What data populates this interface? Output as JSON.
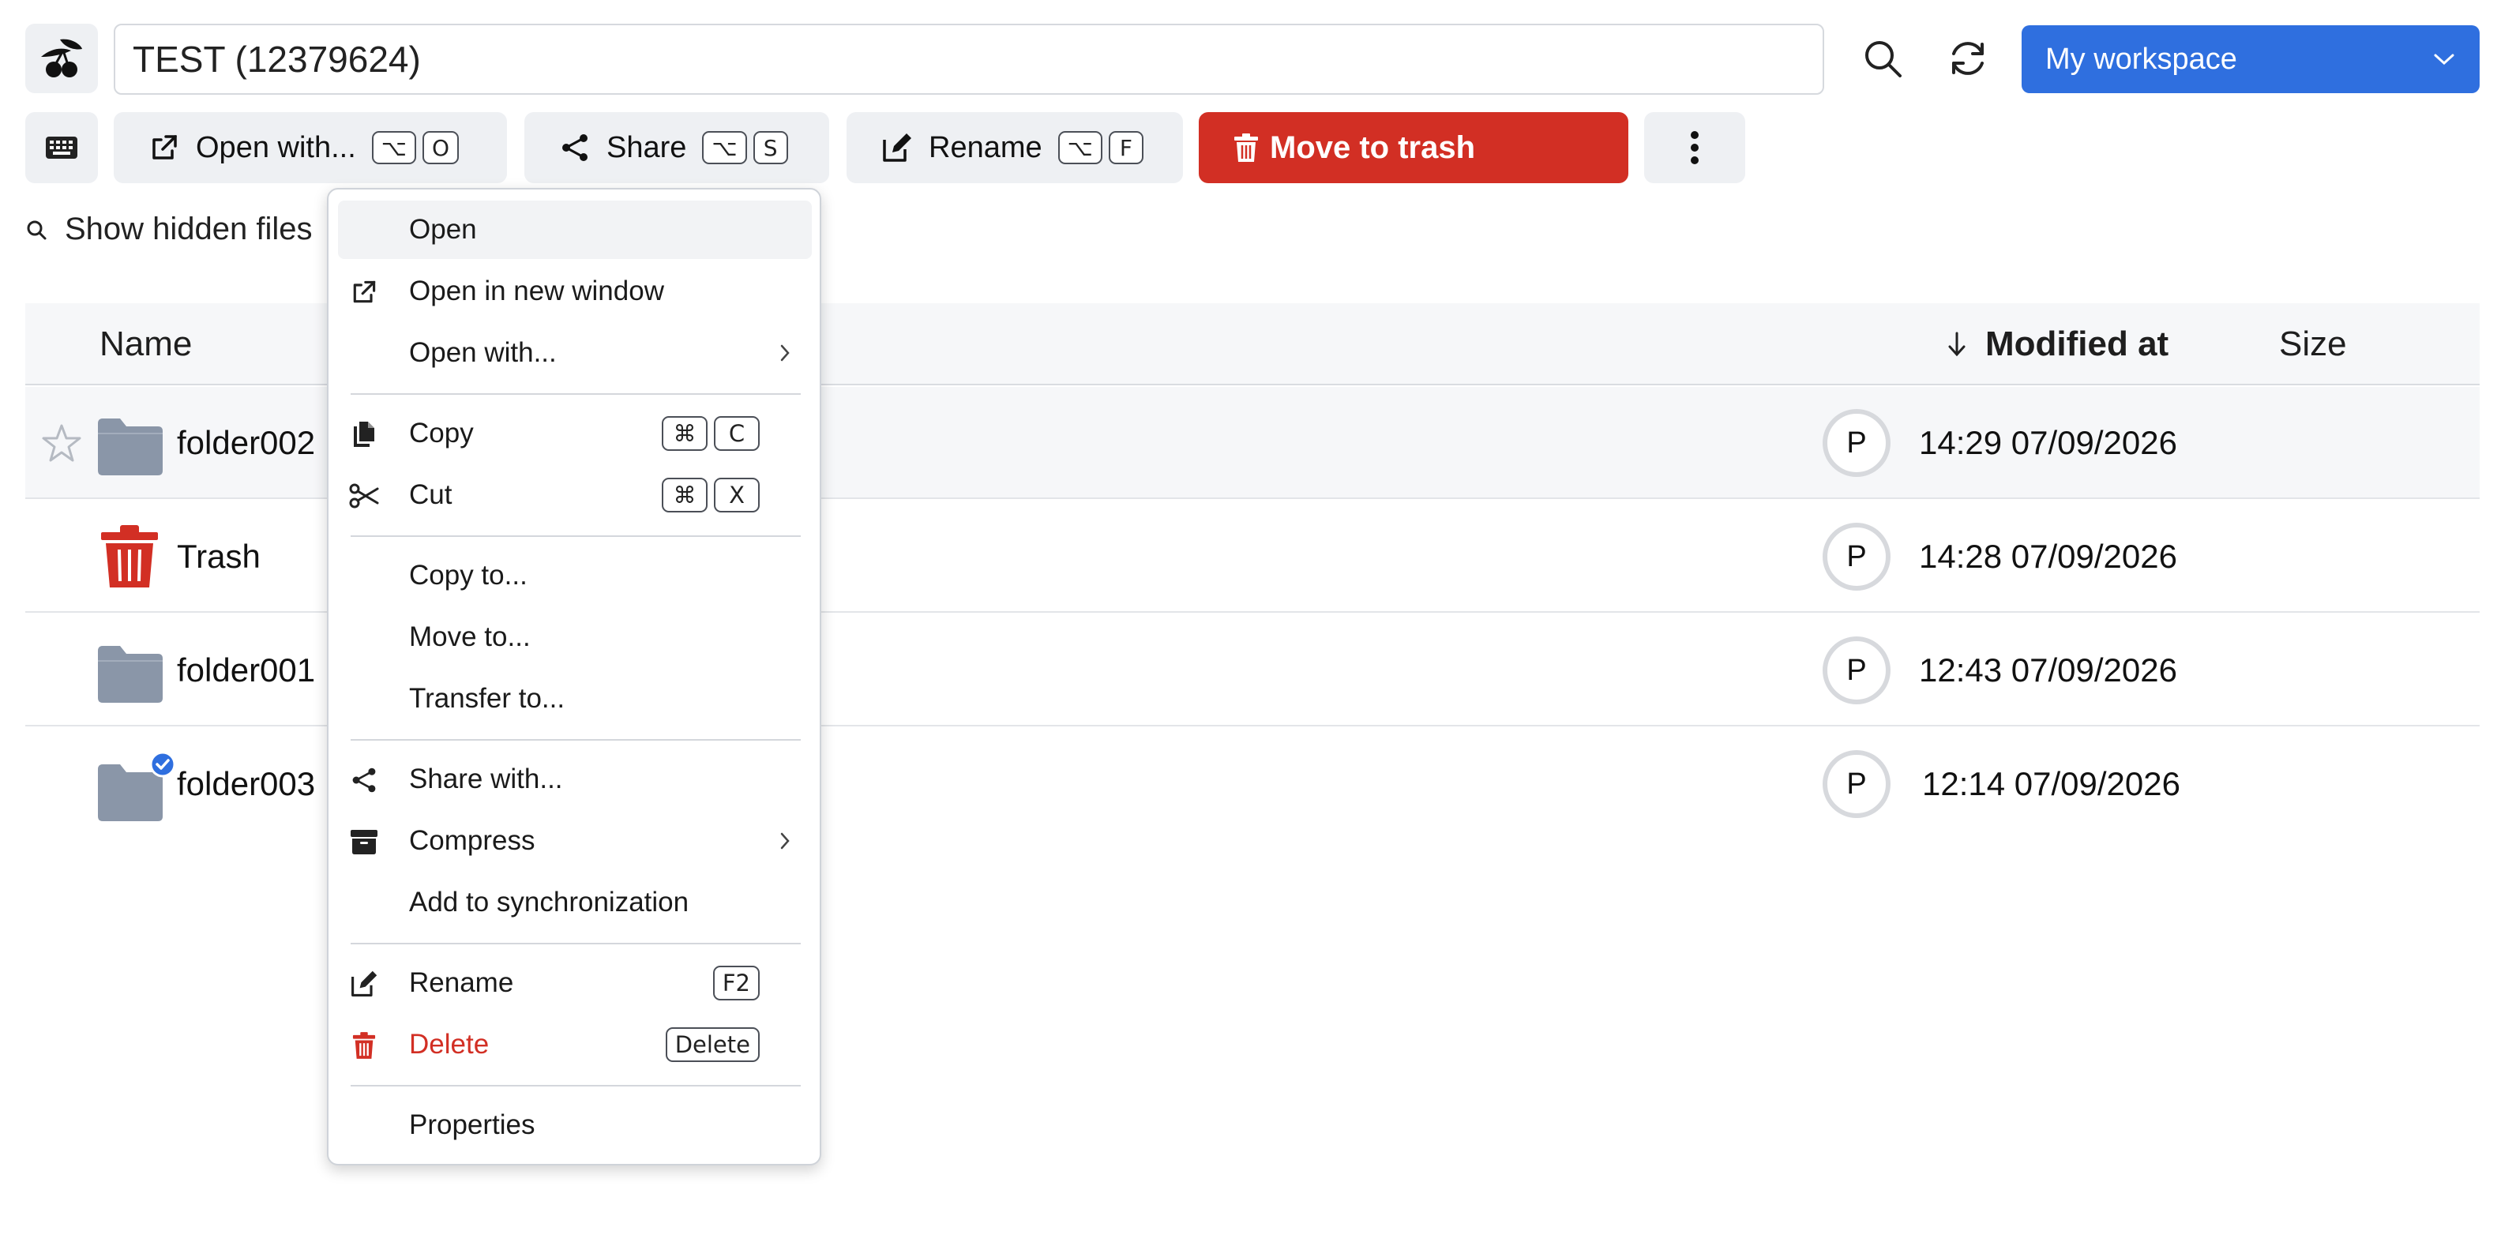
{
  "header": {
    "path": "TEST (12379624)",
    "workspace": "My workspace"
  },
  "toolbar": {
    "open_with": {
      "label": "Open with...",
      "keys": [
        "⌥",
        "O"
      ]
    },
    "share": {
      "label": "Share",
      "keys": [
        "⌥",
        "S"
      ]
    },
    "rename": {
      "label": "Rename",
      "keys": [
        "⌥",
        "F"
      ]
    },
    "trash": {
      "label": "Move to trash"
    }
  },
  "hidden_files": {
    "label": "Show hidden files"
  },
  "table": {
    "columns": {
      "name": "Name",
      "modified": "Modified at",
      "size": "Size"
    },
    "rows": [
      {
        "name": "folder002",
        "owner": "P",
        "modified": "14:29 07/09/2026",
        "icon": "folder-icon",
        "selected": true
      },
      {
        "name": "Trash",
        "owner": "P",
        "modified": "14:28 07/09/2026",
        "icon": "trash-icon"
      },
      {
        "name": "folder001",
        "owner": "P",
        "modified": "12:43 07/09/2026",
        "icon": "folder-icon"
      },
      {
        "name": "folder003",
        "owner": "P",
        "modified": "12:14 07/09/2026",
        "icon": "synced-folder-icon"
      }
    ]
  },
  "context_menu": {
    "open": "Open",
    "open_new_window": "Open in new window",
    "open_with": "Open with...",
    "copy": {
      "label": "Copy",
      "keys": [
        "⌘",
        "C"
      ]
    },
    "cut": {
      "label": "Cut",
      "keys": [
        "⌘",
        "X"
      ]
    },
    "copy_to": "Copy to...",
    "move_to": "Move to...",
    "transfer_to": "Transfer to...",
    "share_with": "Share with...",
    "compress": "Compress",
    "add_sync": "Add to synchronization",
    "rename": {
      "label": "Rename",
      "key": "F2"
    },
    "delete": {
      "label": "Delete",
      "key": "Delete"
    },
    "properties": "Properties"
  },
  "colors": {
    "accent": "#2f6fdf",
    "danger": "#d22f24",
    "folder": "#8a96a8"
  }
}
